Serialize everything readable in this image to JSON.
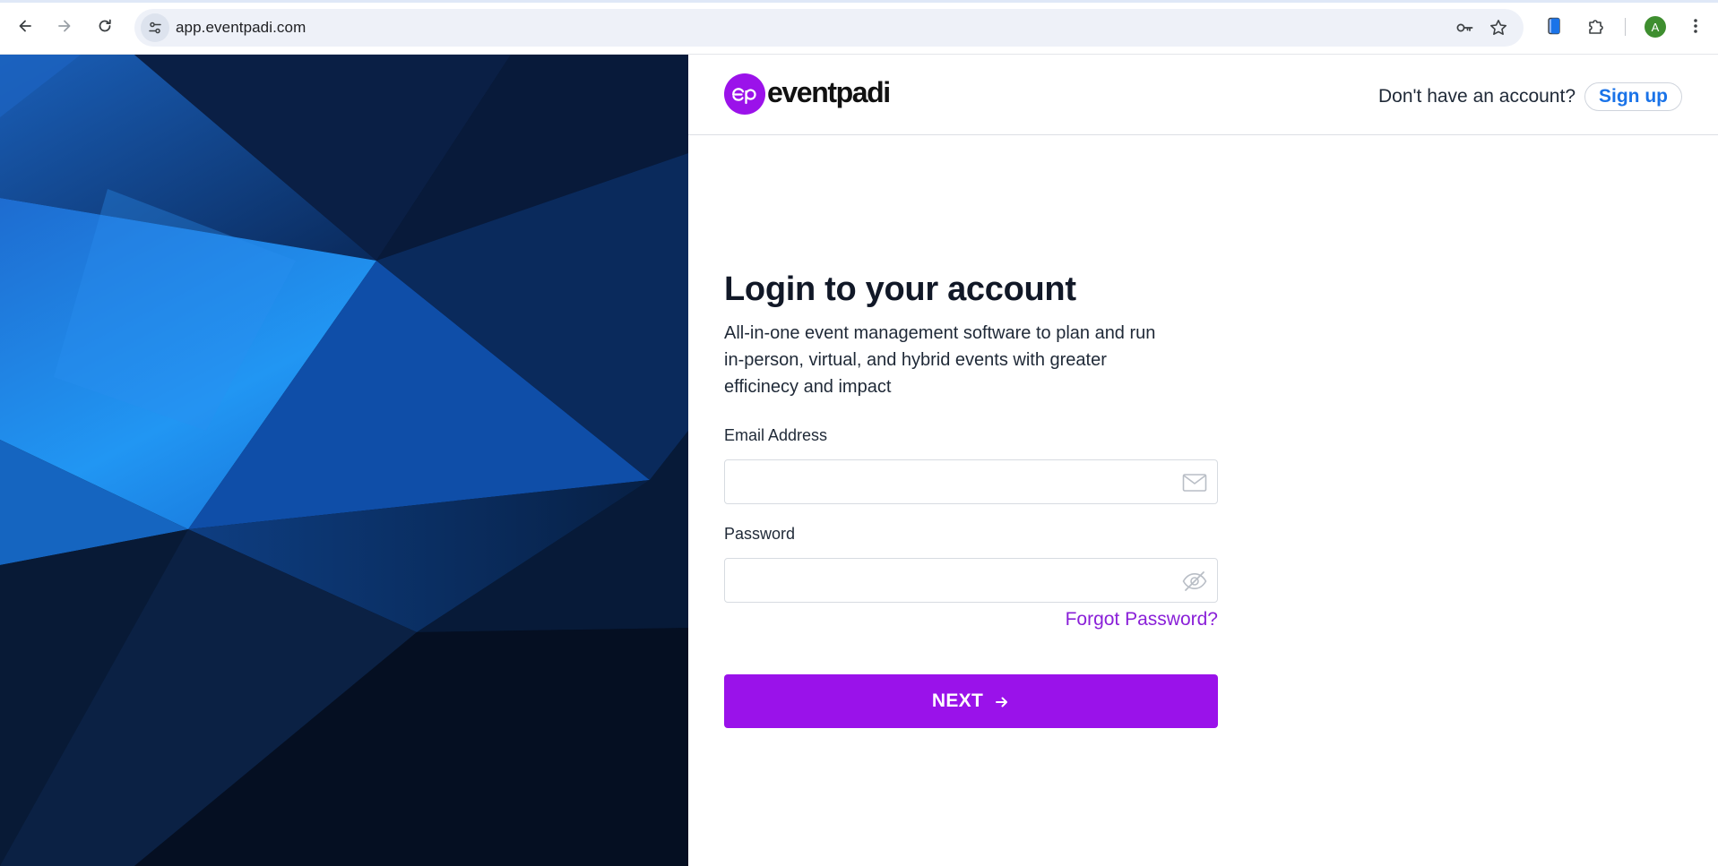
{
  "browser": {
    "url": "app.eventpadi.com",
    "profile_initial": "A",
    "icons": {
      "back": "arrow-left-icon",
      "forward": "arrow-right-icon",
      "reload": "reload-icon",
      "site_info": "tune-icon",
      "password": "key-icon",
      "bookmark": "star-icon",
      "extension_1": "phone-icon",
      "extensions": "puzzle-icon",
      "menu": "kebab-menu-icon"
    }
  },
  "header": {
    "logo_text": "eventpadi",
    "signup_prompt": "Don't have an account?",
    "signup_label": "Sign up"
  },
  "login": {
    "title": "Login to your account",
    "description": "All-in-one event management software to plan and run in-person, virtual, and hybrid events with greater efficinecy and impact",
    "email_label": "Email Address",
    "email_value": "",
    "password_label": "Password",
    "password_value": "",
    "forgot_label": "Forgot Password?",
    "next_label": "NEXT"
  },
  "colors": {
    "brand_purple": "#9a12ea",
    "link_blue": "#1a73e8",
    "forgot_purple": "#8a20d8",
    "art_dark": "#061428",
    "art_blue": "#1e88e5"
  }
}
